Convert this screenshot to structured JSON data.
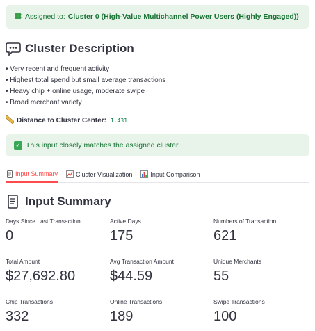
{
  "assigned": {
    "prefix": "Assigned to:",
    "cluster": "Cluster 0 (High-Value Multichannel Power Users (Highly Engaged))"
  },
  "description": {
    "heading": "Cluster Description",
    "bullets": [
      "Very recent and frequent activity",
      "Highest total spend but small average transactions",
      "Heavy chip + online usage, moderate swipe",
      "Broad merchant variety"
    ]
  },
  "distance": {
    "label": "Distance to Cluster Center:",
    "value": "1.431"
  },
  "match_message": "This input closely matches the assigned cluster.",
  "tabs": [
    {
      "label": "Input Summary",
      "icon": "document-icon",
      "active": true
    },
    {
      "label": "Cluster Visualization",
      "icon": "chart-line-icon",
      "active": false
    },
    {
      "label": "Input Comparison",
      "icon": "bar-chart-icon",
      "active": false
    }
  ],
  "summary": {
    "heading": "Input Summary",
    "metrics": [
      {
        "label": "Days Since Last Transaction",
        "value": "0"
      },
      {
        "label": "Active Days",
        "value": "175"
      },
      {
        "label": "Numbers of Transaction",
        "value": "621"
      },
      {
        "label": "Total Amount",
        "value": "$27,692.80"
      },
      {
        "label": "Avg Transaction Amount",
        "value": "$44.59"
      },
      {
        "label": "Unique Merchants",
        "value": "55"
      },
      {
        "label": "Chip Transactions",
        "value": "332"
      },
      {
        "label": "Online Transactions",
        "value": "189"
      },
      {
        "label": "Swipe Transactions",
        "value": "100"
      }
    ]
  },
  "colors": {
    "success_bg": "#e8f4ea",
    "success_text": "#177233",
    "tab_active": "#ff4b4b",
    "text": "#31333f"
  }
}
